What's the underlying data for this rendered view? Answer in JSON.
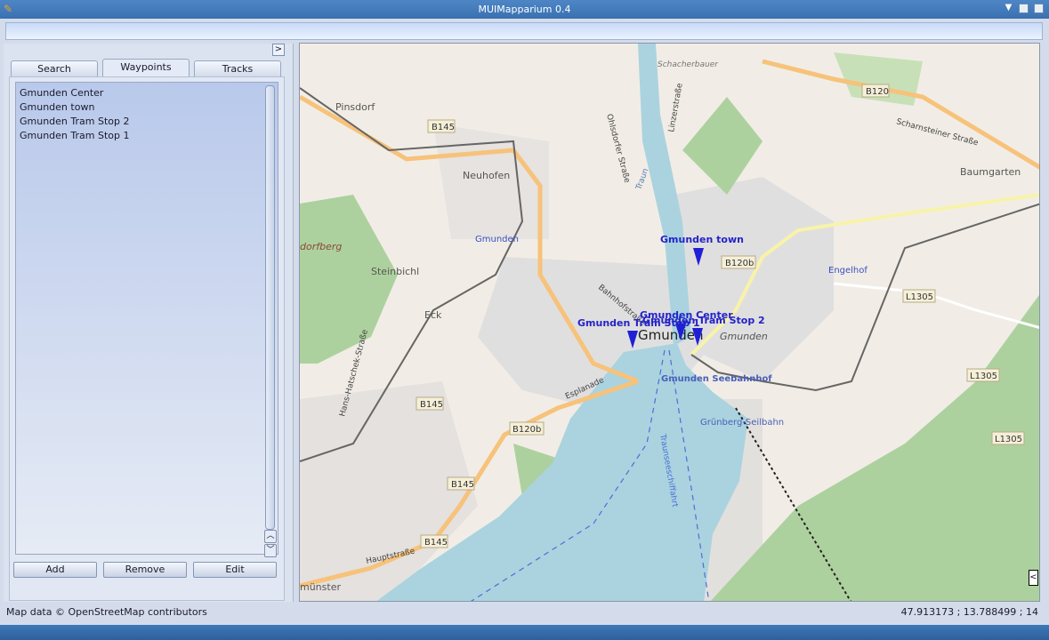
{
  "window": {
    "title": "MUIMapparium 0.4",
    "buttons": [
      "minimize",
      "maximize",
      "iconify"
    ]
  },
  "sidebar": {
    "collapse_label": ">",
    "tabs": [
      {
        "label": "Search"
      },
      {
        "label": "Waypoints",
        "active": true
      },
      {
        "label": "Tracks"
      }
    ],
    "waypoints": [
      "Gmunden Center",
      "Gmunden town",
      "Gmunden Tram Stop 2",
      "Gmunden Tram Stop 1"
    ],
    "buttons": {
      "add": "Add",
      "remove": "Remove",
      "edit": "Edit"
    }
  },
  "map": {
    "markers": [
      {
        "label": "Gmunden town"
      },
      {
        "label": "Gmunden Center"
      },
      {
        "label": "Gmunden Tram Stop 2"
      },
      {
        "label": "Gmunden Tram Stop 1"
      }
    ],
    "place_labels": [
      "Pinsdorf",
      "Neuhofen",
      "Steinbichl",
      "Eck",
      "Gmunden",
      "Gmunden",
      "Baumgarten",
      "Engelhof",
      "Gmunden",
      "Gmunden Seebahnhof",
      "Grünberg-Seilbahn",
      "Schacherbauer",
      "Esplanade",
      "Hauptstraße",
      "Traunseeschiffahrt",
      "Bahnhofstraße",
      "Linzerstraße",
      "Ohlsdorfer Straße",
      "Scharnsteiner Straße",
      "Hans-Hatschek-Straße",
      "dorfberg",
      "münster",
      "Traun"
    ],
    "road_shields": [
      "B145",
      "B120",
      "B120b",
      "L1305",
      "L1305",
      "B145",
      "B120b",
      "B145",
      "B145",
      "L1305"
    ],
    "nav_label": "<",
    "colors": {
      "land": "#f1ede6",
      "water": "#aad3df",
      "forest": "#add19e",
      "residential": "#e0dfdf",
      "marker": "#1f1fd6"
    }
  },
  "status": {
    "attribution": "Map data © OpenStreetMap contributors",
    "coordinates": "47.913173 ; 13.788499 ; 14"
  }
}
